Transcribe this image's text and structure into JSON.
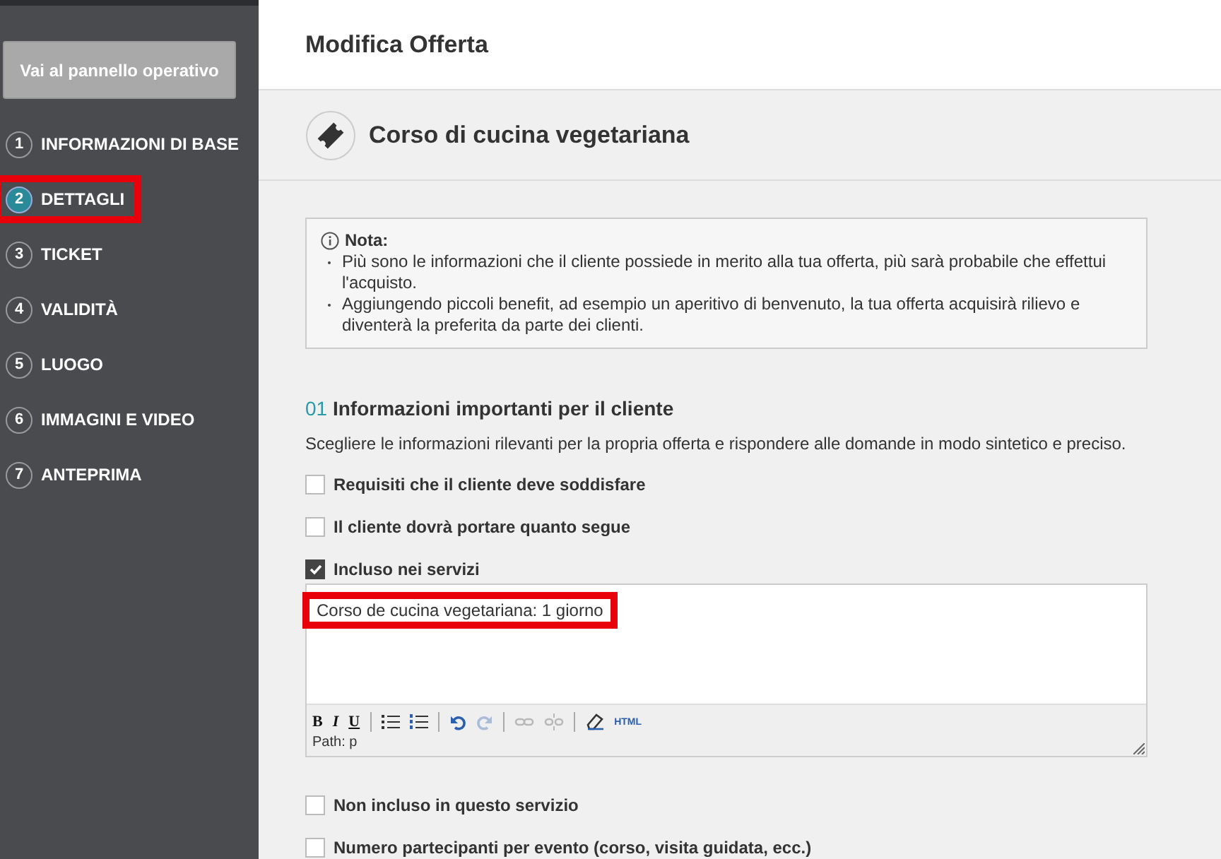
{
  "sidebar": {
    "dashboard_button": "Vai al pannello operativo",
    "steps": [
      {
        "number": "1",
        "label": "INFORMAZIONI DI BASE",
        "selected": false,
        "highlighted": false
      },
      {
        "number": "2",
        "label": "DETTAGLI",
        "selected": true,
        "highlighted": true
      },
      {
        "number": "3",
        "label": "TICKET",
        "selected": false,
        "highlighted": false
      },
      {
        "number": "4",
        "label": "VALIDITÀ",
        "selected": false,
        "highlighted": false
      },
      {
        "number": "5",
        "label": "LUOGO",
        "selected": false,
        "highlighted": false
      },
      {
        "number": "6",
        "label": "IMMAGINI E VIDEO",
        "selected": false,
        "highlighted": false
      },
      {
        "number": "7",
        "label": "ANTEPRIMA",
        "selected": false,
        "highlighted": false
      }
    ]
  },
  "page_title": "Modifica Offerta",
  "offer_title": "Corso di cucina vegetariana",
  "note": {
    "title": "Nota:",
    "items": [
      "Più sono le informazioni che il cliente possiede in merito alla tua offerta, più sarà probabile che effettui l'acquisto.",
      "Aggiungendo piccoli benefit, ad esempio un aperitivo di benvenuto, la tua offerta acquisirà rilievo e diventerà la preferita da parte dei clienti."
    ]
  },
  "section": {
    "number": "01",
    "title": "Informazioni importanti per il cliente",
    "description": "Scegliere le informazioni rilevanti per la propria offerta e rispondere alle domande in modo sintetico e preciso.",
    "options": [
      {
        "label": "Requisiti che il cliente deve soddisfare",
        "checked": false
      },
      {
        "label": "Il cliente dovrà portare quanto segue",
        "checked": false
      },
      {
        "label": "Incluso nei servizi",
        "checked": true,
        "editor": {
          "value": "Corso de cucina vegetariana: 1 giorno",
          "highlighted": true,
          "path": "Path: p",
          "toolbar": [
            {
              "kind": "bold",
              "text": "B",
              "disabled": false
            },
            {
              "kind": "italic",
              "text": "I",
              "disabled": false
            },
            {
              "kind": "underline",
              "text": "U",
              "disabled": false
            },
            {
              "kind": "separator"
            },
            {
              "kind": "bullets",
              "disabled": false
            },
            {
              "kind": "numbers",
              "disabled": false
            },
            {
              "kind": "separator"
            },
            {
              "kind": "undo",
              "disabled": false
            },
            {
              "kind": "redo",
              "disabled": true
            },
            {
              "kind": "separator"
            },
            {
              "kind": "link",
              "disabled": true
            },
            {
              "kind": "unlink",
              "disabled": true
            },
            {
              "kind": "separator"
            },
            {
              "kind": "eraser",
              "disabled": false
            },
            {
              "kind": "html",
              "text": "HTML",
              "disabled": false
            }
          ]
        }
      },
      {
        "label": "Non incluso in questo servizio",
        "checked": false
      },
      {
        "label": "Numero partecipanti per evento (corso, visita guidata, ecc.)",
        "checked": false
      }
    ]
  }
}
